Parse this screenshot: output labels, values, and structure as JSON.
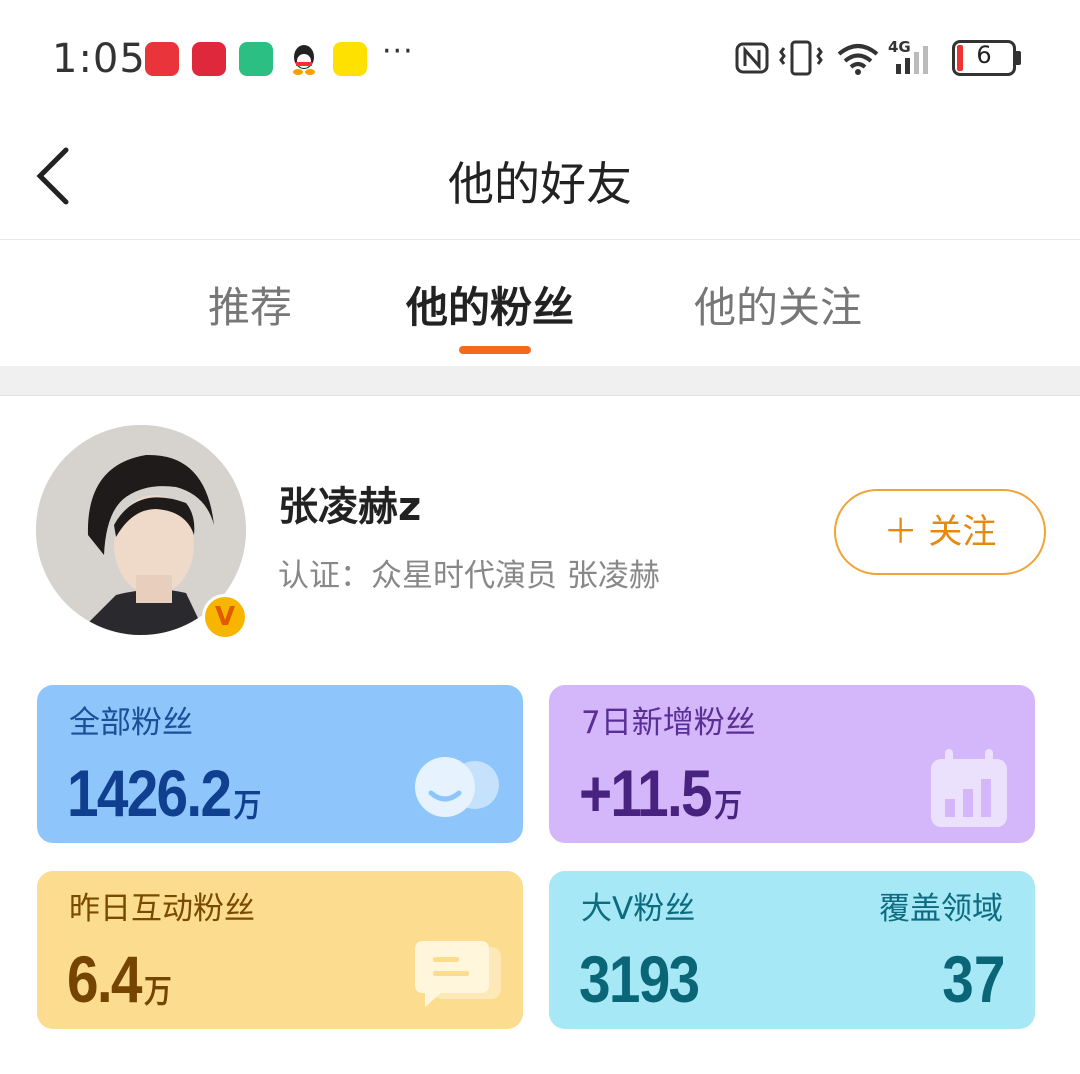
{
  "status_bar": {
    "time": "1:05",
    "battery": "6",
    "network": "4G"
  },
  "header": {
    "title": "他的好友"
  },
  "tabs": [
    {
      "label": "推荐",
      "active": false
    },
    {
      "label": "他的粉丝",
      "active": true
    },
    {
      "label": "他的关注",
      "active": false
    }
  ],
  "profile": {
    "name": "张凌赫z",
    "verification": "认证：众星时代演员 张凌赫",
    "badge": "V",
    "follow_label": "＋ 关注"
  },
  "stats": {
    "total_fans": {
      "label": "全部粉丝",
      "value": "1426.2",
      "unit": "万"
    },
    "new_fans_7d": {
      "label": "7日新增粉丝",
      "value": "+11.5",
      "unit": "万"
    },
    "interactive_fans_yesterday": {
      "label": "昨日互动粉丝",
      "value": "6.4",
      "unit": "万"
    },
    "big_v_fans": {
      "label": "大V粉丝",
      "value": "3193",
      "coverage_label": "覆盖领域",
      "coverage_value": "37"
    }
  },
  "colors": {
    "accent": "#f26b1d",
    "follow": "#e8890f",
    "card_blue": "#8ec6fb",
    "card_purple": "#d4b6fa",
    "card_yellow": "#fcdd90",
    "card_cyan": "#a6e8f6"
  }
}
